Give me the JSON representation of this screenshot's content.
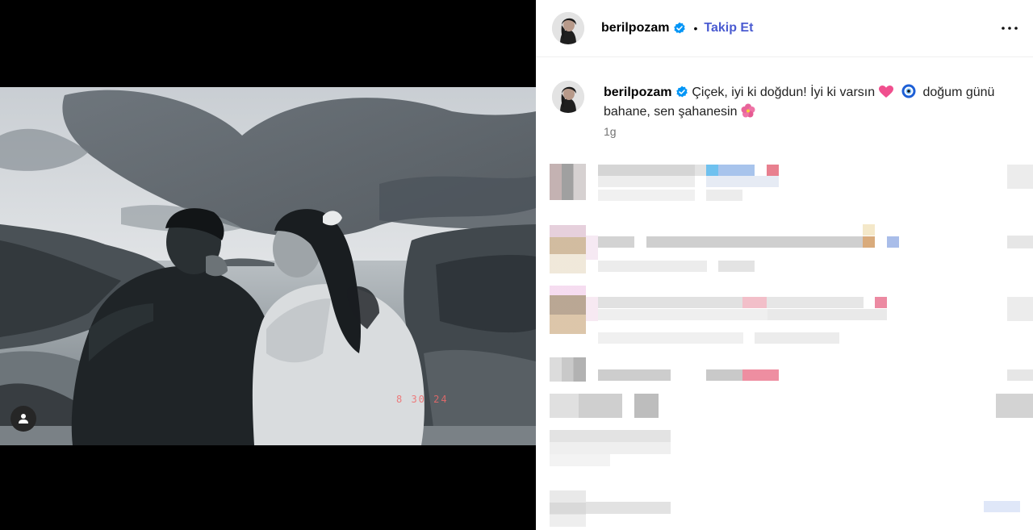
{
  "post": {
    "username": "berilpozam",
    "follow_label": "Takip Et",
    "separator": "•",
    "verified": true,
    "date_stamp": "8 30 24"
  },
  "caption": {
    "username": "berilpozam",
    "text_part1": "Çiçek, iyi ki doğdun! İyi ki varsın",
    "text_part2": "doğum günü bahane, sen şahanesin",
    "time": "1g"
  },
  "icons": {
    "verified": "verified-badge-icon",
    "more": "more-options-icon",
    "tag": "user-tag-icon",
    "heart_emoji": "pink-heart-emoji",
    "evil_eye_emoji": "evil-eye-emoji",
    "flower_emoji": "hibiscus-emoji"
  },
  "colors": {
    "follow": "#4a5bd1",
    "verified": "#0095f6",
    "time": "#737373",
    "divider": "#efefef"
  }
}
